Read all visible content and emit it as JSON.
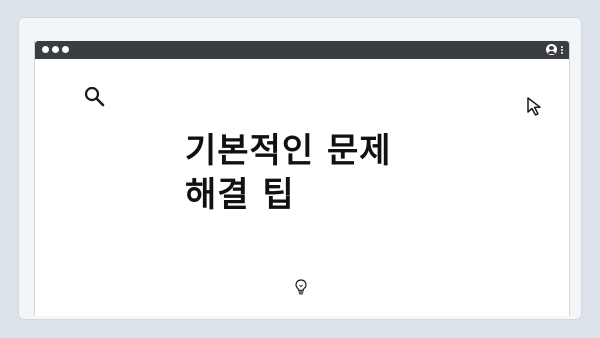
{
  "page": {
    "title_line1": "기본적인 문제",
    "title_line2": "해결 팁"
  },
  "icons": {
    "search": "search-icon",
    "cursor": "cursor-pointer-icon",
    "lightbulb": "lightbulb-icon",
    "profile": "profile-icon",
    "menu": "kebab-menu-icon"
  },
  "colors": {
    "background": "#dde3ea",
    "card": "#f3f6f9",
    "titlebar": "#3a3d42",
    "text": "#111111"
  }
}
